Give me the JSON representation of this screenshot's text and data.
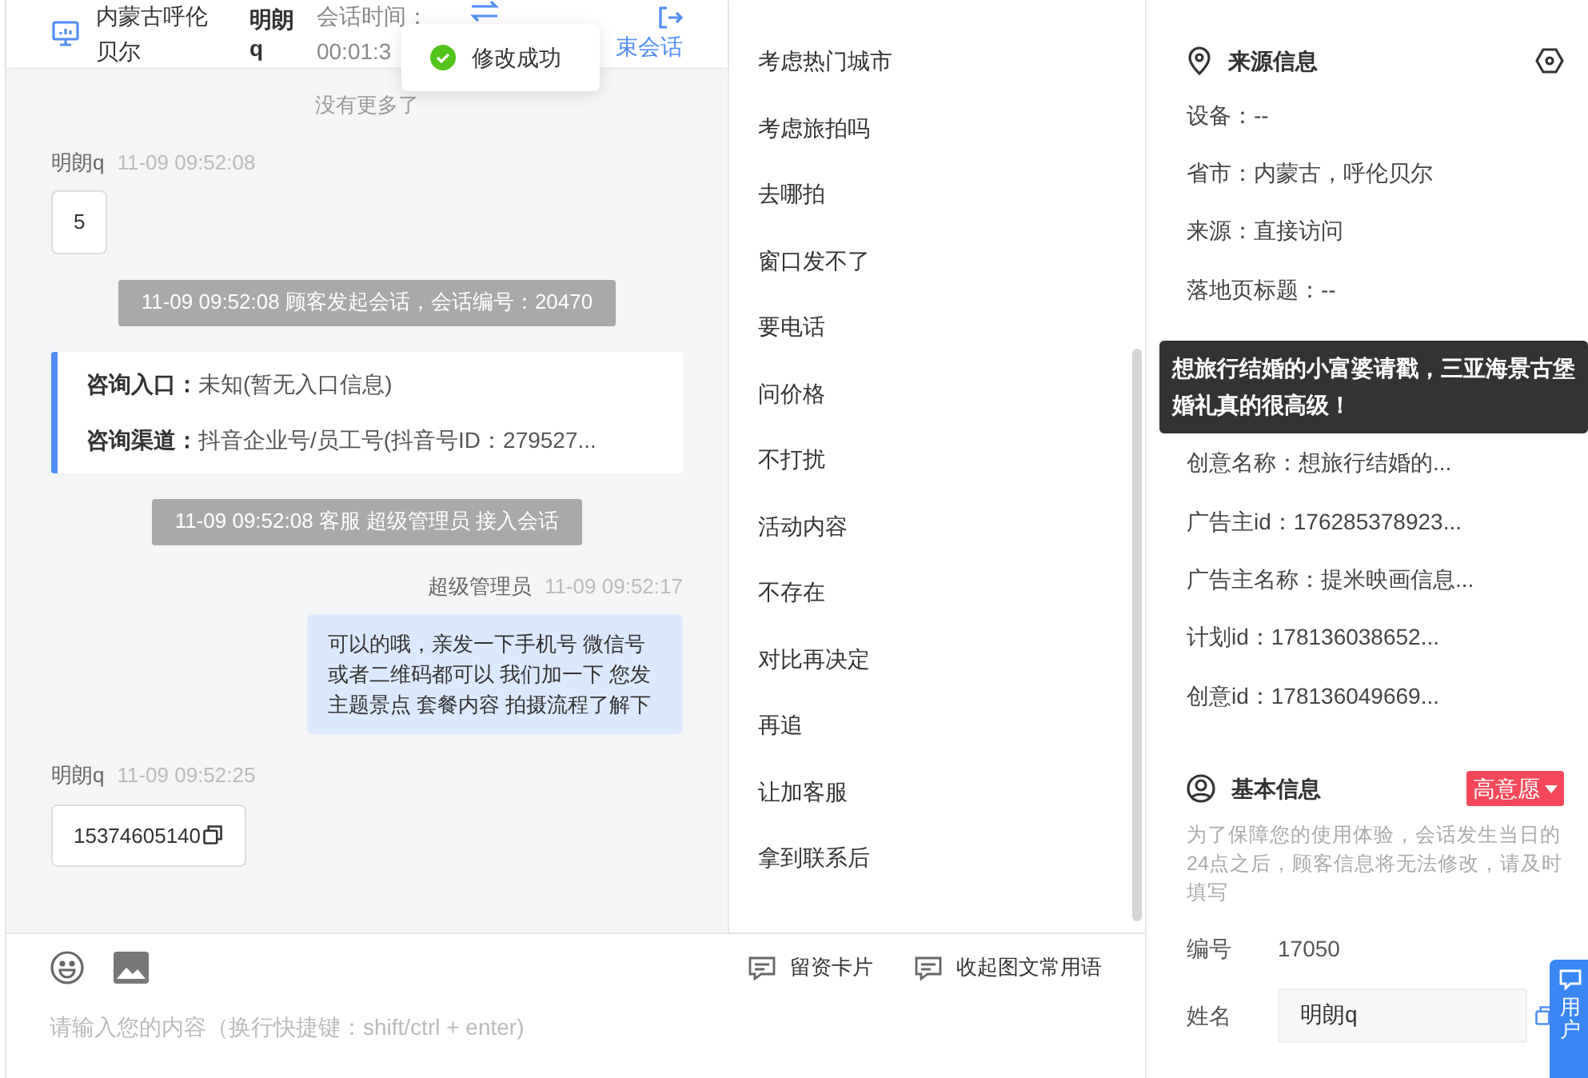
{
  "header": {
    "location": [
      "内蒙古呼伦",
      "贝尔"
    ],
    "customer": [
      "明朗",
      "q"
    ],
    "session_time_label": "会话时间：",
    "session_time": "00:01:3",
    "end_label": "束会话"
  },
  "toast": {
    "text": "修改成功"
  },
  "messages": [
    {
      "kind": "notice",
      "text": "没有更多了"
    },
    {
      "kind": "customer",
      "sender": "明朗q",
      "time": "11-09 09:52:08",
      "text": "5",
      "copyable": false
    },
    {
      "kind": "system",
      "text": "11-09 09:52:08 顾客发起会话，会话编号：20470"
    },
    {
      "kind": "info_card",
      "rows": [
        {
          "label": "咨询入口：",
          "value": "未知(暂无入口信息)"
        },
        {
          "label": "咨询渠道：",
          "value": "抖音企业号/员工号(抖音号ID：279527..."
        }
      ]
    },
    {
      "kind": "system",
      "text": "11-09 09:52:08 客服 超级管理员 接入会话"
    },
    {
      "kind": "agent",
      "sender": "超级管理员",
      "time": "11-09 09:52:17",
      "text": "可以的哦，亲发一下手机号 微信号或者二维码都可以 我们加一下 您发主题景点 套餐内容 拍摄流程了解下"
    },
    {
      "kind": "customer",
      "sender": "明朗q",
      "time": "11-09 09:52:25",
      "text": "15374605140",
      "copyable": true
    }
  ],
  "composer": {
    "tools": [
      "留资卡片",
      "收起图文常用语"
    ],
    "placeholder": "请输入您的内容（换行快捷键：shift/ctrl + enter)"
  },
  "phrases": [
    "考虑热门城市",
    "考虑旅拍吗",
    "去哪拍",
    "窗口发不了",
    "要电话",
    "问价格",
    "不打扰",
    "活动内容",
    "不存在",
    "对比再决定",
    "再追",
    "让加客服",
    "拿到联系后"
  ],
  "source_info": {
    "title": "来源信息",
    "rows_top": [
      "设备：--",
      "省市：内蒙古，呼伦贝尔",
      "来源：直接访问",
      "落地页标题：--"
    ],
    "rows_bottom": [
      "创意名称：想旅行结婚的...",
      "广告主id：176285378923...",
      "广告主名称：提米映画信息...",
      "计划id：178136038652...",
      "创意id：178136049669..."
    ]
  },
  "tooltip": "想旅行结婚的小富婆请戳，三亚海景古堡婚礼真的很高级！",
  "basic_info": {
    "title": "基本信息",
    "intent": "高意愿",
    "note": "为了保障您的使用体验，会话发生当日的24点之后，顾客信息将无法修改，请及时填写",
    "fields": [
      {
        "kind": "text",
        "label": "编号",
        "value": "17050"
      },
      {
        "kind": "input",
        "label": "姓名",
        "value": "明朗q"
      }
    ]
  },
  "feedback_tab": "用户"
}
